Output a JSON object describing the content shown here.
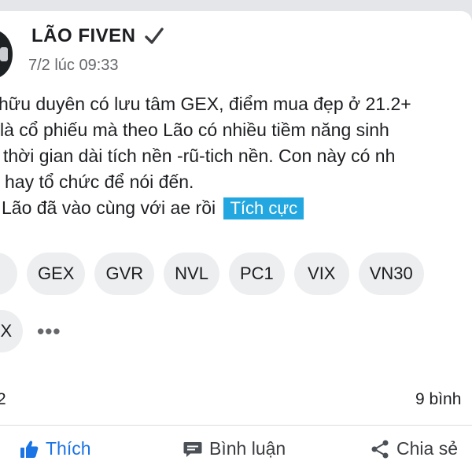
{
  "post": {
    "author": "LÃO FIVEN",
    "timestamp": "7/2 lúc 09:33",
    "lines": [
      "hữu duyên có lưu tâm GEX, điểm mua đẹp ở 21.2+",
      " là cổ phiếu mà theo Lão có nhiều tiềm năng sinh",
      "thời gian dài tích nền -rũ-tich nền. Con này có nh",
      "hay tổ chức để nói đến.",
      "Lão đã vào cùng với ae rồi"
    ],
    "sentiment": "Tích cực"
  },
  "tags": {
    "row1": [
      "",
      "GEX",
      "GVR",
      "NVL",
      "PC1",
      "VIX",
      "VN30"
    ],
    "row2": [
      "NDEX"
    ],
    "more": "•••"
  },
  "stats": {
    "reactions": "2",
    "comments": "9 bình"
  },
  "actions": {
    "like": "Thích",
    "comment": "Bình luận",
    "share": "Chia sẻ"
  },
  "colors": {
    "accent": "#1b74e4",
    "sentiment_bg": "#23a7e0",
    "tag_bg": "#edeef0",
    "text_muted": "#65676b"
  },
  "icons": {
    "verified": "checkmark-icon",
    "like": "thumbs-up-icon",
    "comment": "comment-bubble-icon",
    "share": "share-icon",
    "more": "more-dots-icon"
  }
}
